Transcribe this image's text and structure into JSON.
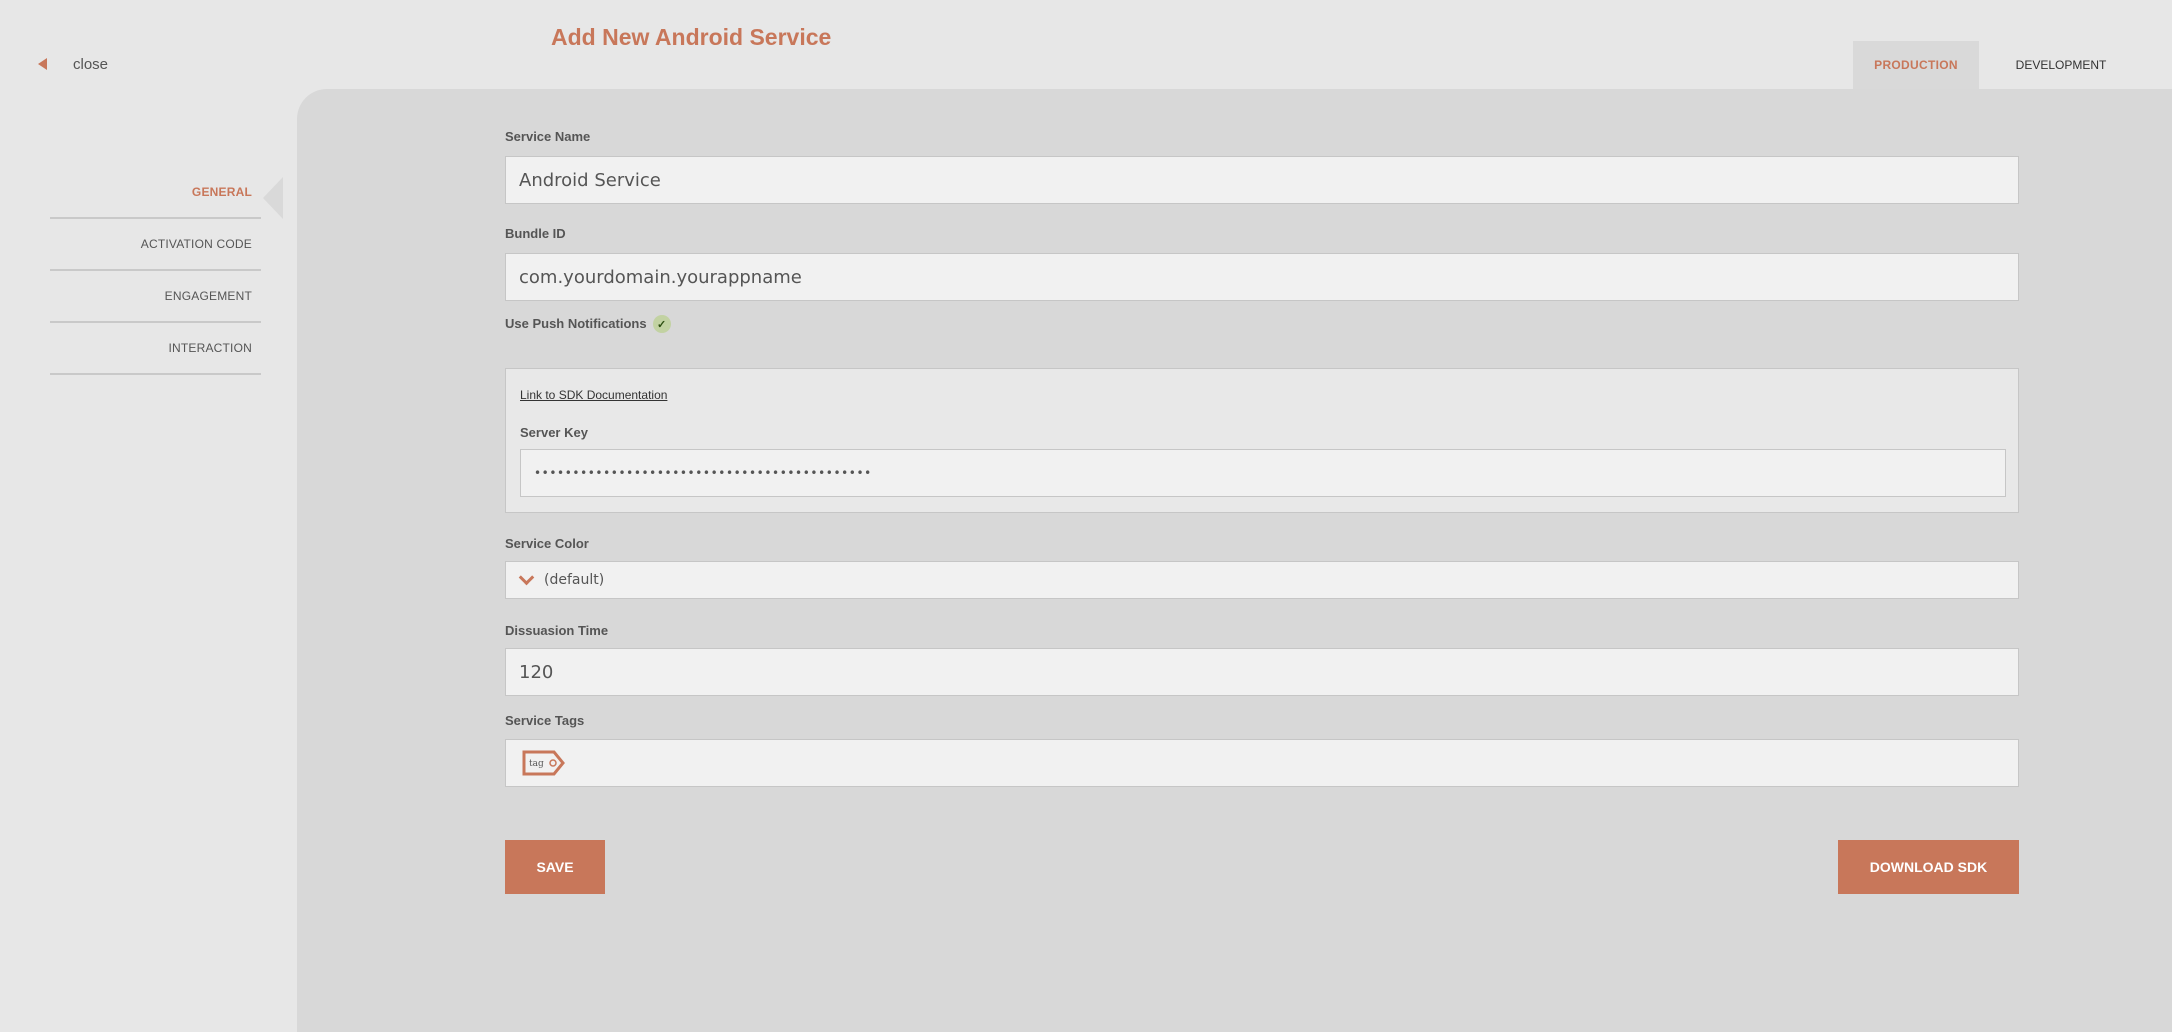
{
  "header": {
    "close_label": "close",
    "title": "Add New Android Service",
    "tabs": [
      {
        "label": "PRODUCTION",
        "active": true
      },
      {
        "label": "DEVELOPMENT",
        "active": false
      }
    ]
  },
  "sidebar": {
    "items": [
      {
        "label": "GENERAL",
        "active": true
      },
      {
        "label": "ACTIVATION CODE",
        "active": false
      },
      {
        "label": "ENGAGEMENT",
        "active": false
      },
      {
        "label": "INTERACTION",
        "active": false
      }
    ]
  },
  "form": {
    "service_name": {
      "label": "Service Name",
      "value": "Android Service"
    },
    "bundle_id": {
      "label": "Bundle ID",
      "value": "com.yourdomain.yourappname"
    },
    "push": {
      "label": "Use Push Notifications",
      "checked": true,
      "sdk_link": "Link to SDK Documentation",
      "server_key_label": "Server Key",
      "server_key_value": "••••••••••••••••••••••••••••••••••••••••••••"
    },
    "service_color": {
      "label": "Service Color",
      "value": "(default)"
    },
    "dissuasion_time": {
      "label": "Dissuasion Time",
      "value": "120"
    },
    "service_tags": {
      "label": "Service Tags",
      "tag_icon_text": "tag"
    }
  },
  "buttons": {
    "save": "SAVE",
    "download_sdk": "DOWNLOAD SDK"
  },
  "colors": {
    "accent": "#c8775a",
    "page_bg": "#e7e7e7",
    "panel_bg": "#d8d8d8",
    "input_bg": "#f1f1f1",
    "check_bg": "#c2d2a2"
  },
  "icons": [
    "close-arrow-icon",
    "check-icon",
    "chevron-down-icon",
    "tag-icon"
  ]
}
